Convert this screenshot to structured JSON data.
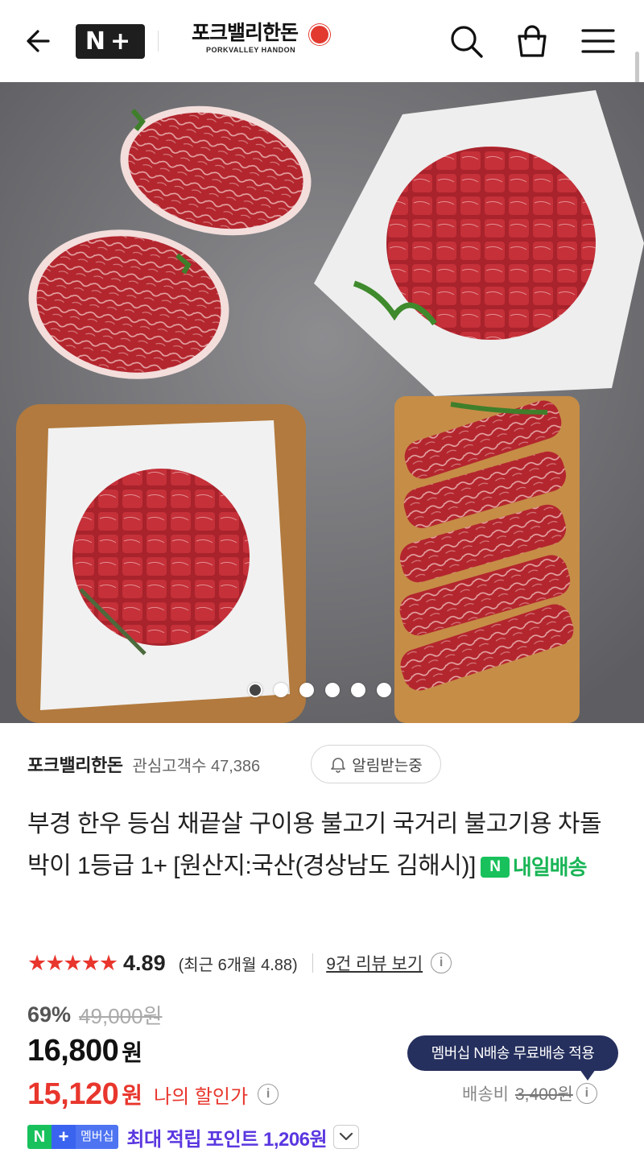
{
  "header": {
    "back_icon": "arrow-left-icon",
    "nplus_logo": "N+",
    "brand_name": "포크밸리한돈",
    "brand_sub": "PORKVALLEY HANDON",
    "search_icon": "search-icon",
    "bag_icon": "shopping-bag-icon",
    "menu_icon": "hamburger-menu-icon"
  },
  "gallery": {
    "total_slides": 6,
    "active_index": 0
  },
  "store": {
    "name": "포크밸리한돈",
    "followers_label": "관심고객수 47,386",
    "alarm_label": "알림받는중"
  },
  "product": {
    "title": "부경 한우 등심 채끝살 구이용 불고기 국거리 불고기용 차돌박이 1등급 1+ [원산지:국산(경상남도 김해시)]",
    "delivery_badge": "N",
    "delivery_label": "내일배송"
  },
  "rating": {
    "stars": "★★★★★",
    "score": "4.89",
    "recent": "(최근 6개월 4.88)",
    "review_link": "9건 리뷰 보기",
    "info": "i"
  },
  "pricing": {
    "discount_rate": "69%",
    "original_price": "49,000원",
    "price": "16,800",
    "price_unit": "원",
    "my_price": "15,120",
    "my_price_unit": "원",
    "my_price_label": "나의 할인가",
    "member_tooltip": "멤버십 N배송 무료배송 적용",
    "shipping_label": "배송비",
    "shipping_fee": "3,400원"
  },
  "points": {
    "badge_n": "N",
    "badge_plus": "+",
    "badge_member": "멤버십",
    "text": "최대 적립 포인트 1,206원"
  },
  "colors": {
    "accent_red": "#e8362d",
    "naver_green": "#19c15d",
    "points_purple": "#5a37e0",
    "tooltip_navy": "#26305e"
  }
}
